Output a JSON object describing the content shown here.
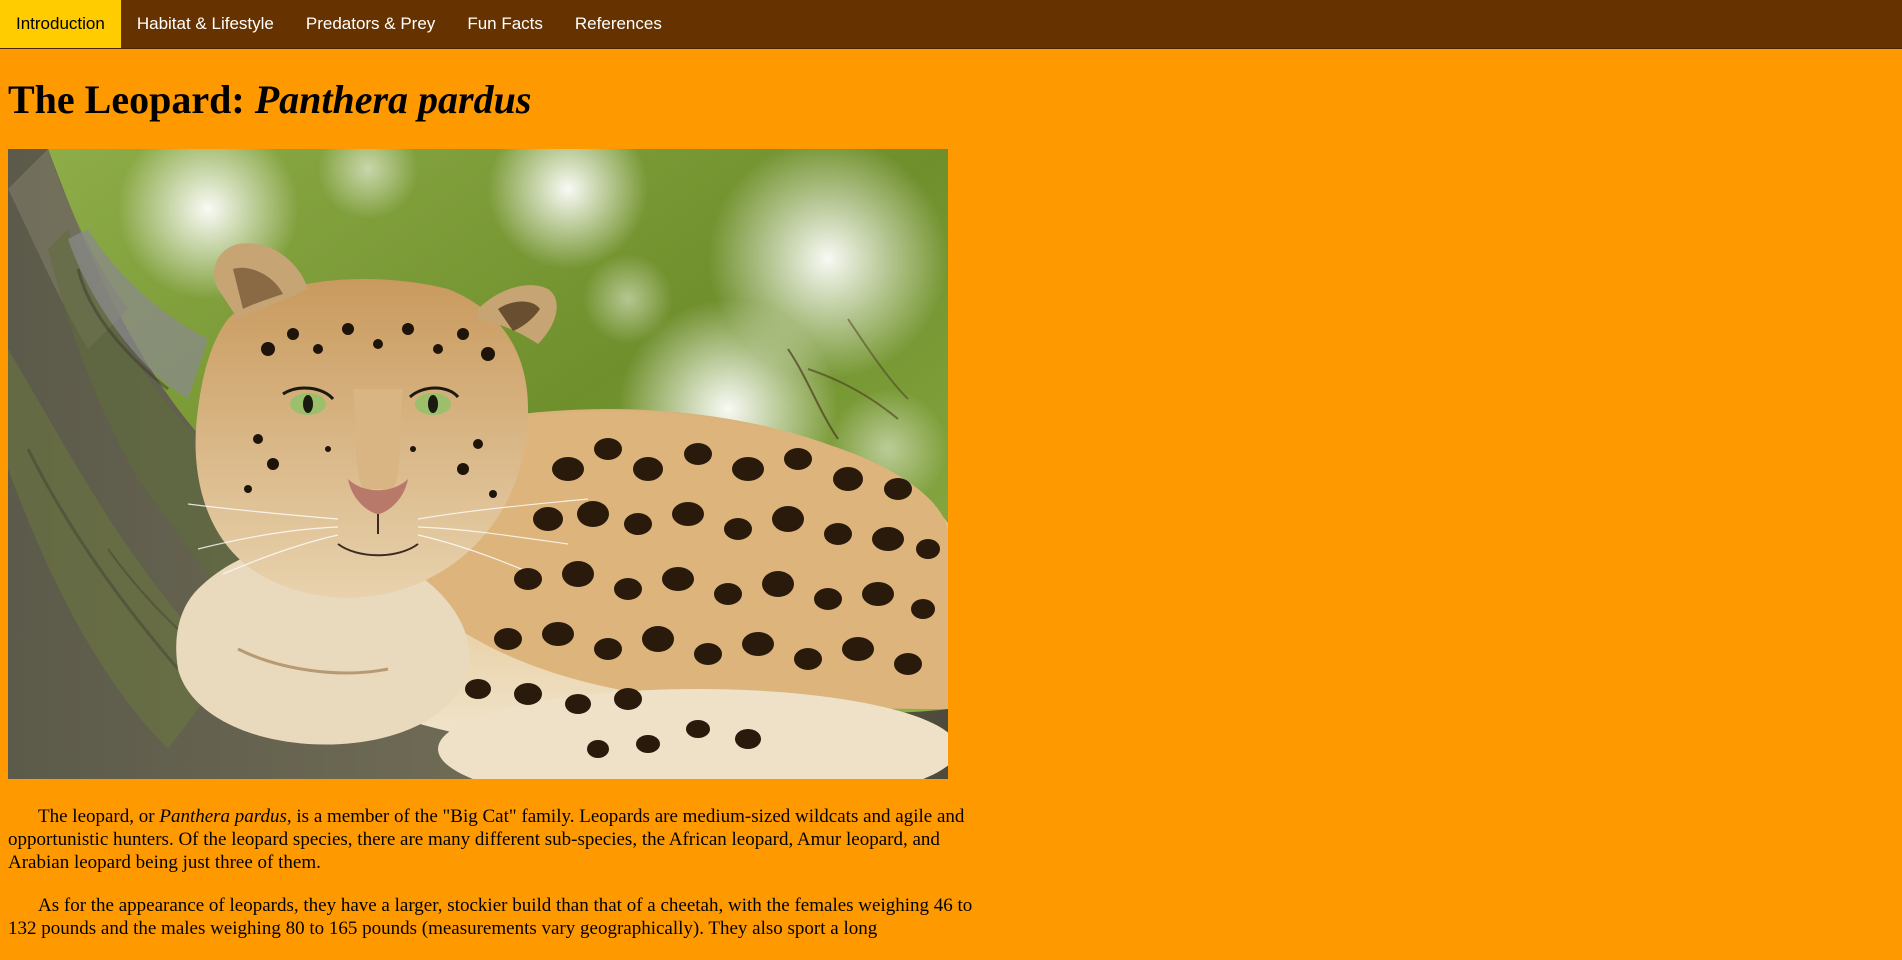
{
  "nav": {
    "items": [
      {
        "label": "Introduction"
      },
      {
        "label": "Habitat & Lifestyle"
      },
      {
        "label": "Predators & Prey"
      },
      {
        "label": "Fun Facts"
      },
      {
        "label": "References"
      }
    ],
    "active_color": "#ffcc00",
    "bar_color": "#663300"
  },
  "page": {
    "background": "#ff9900",
    "title_plain": "The Leopard: ",
    "title_italic": "Panthera pardus"
  },
  "hero_image": {
    "subject": "leopard-resting-on-tree-branch"
  },
  "content": {
    "p1_pre": "The leopard, or ",
    "p1_italic": "Panthera pardus",
    "p1_post": ", is a member of the \"Big Cat\" family. Leopards are medium-sized wildcats and agile and opportunistic hunters. Of the leopard species, there are many different sub-species, the African leopard, Amur leopard, and Arabian leopard being just three of them.",
    "p2": "As for the appearance of leopards, they have a larger, stockier build than that of a cheetah, with the females weighing 46 to 132 pounds and the males weighing 80 to 165 pounds (measurements vary geographically). They also sport a long"
  }
}
